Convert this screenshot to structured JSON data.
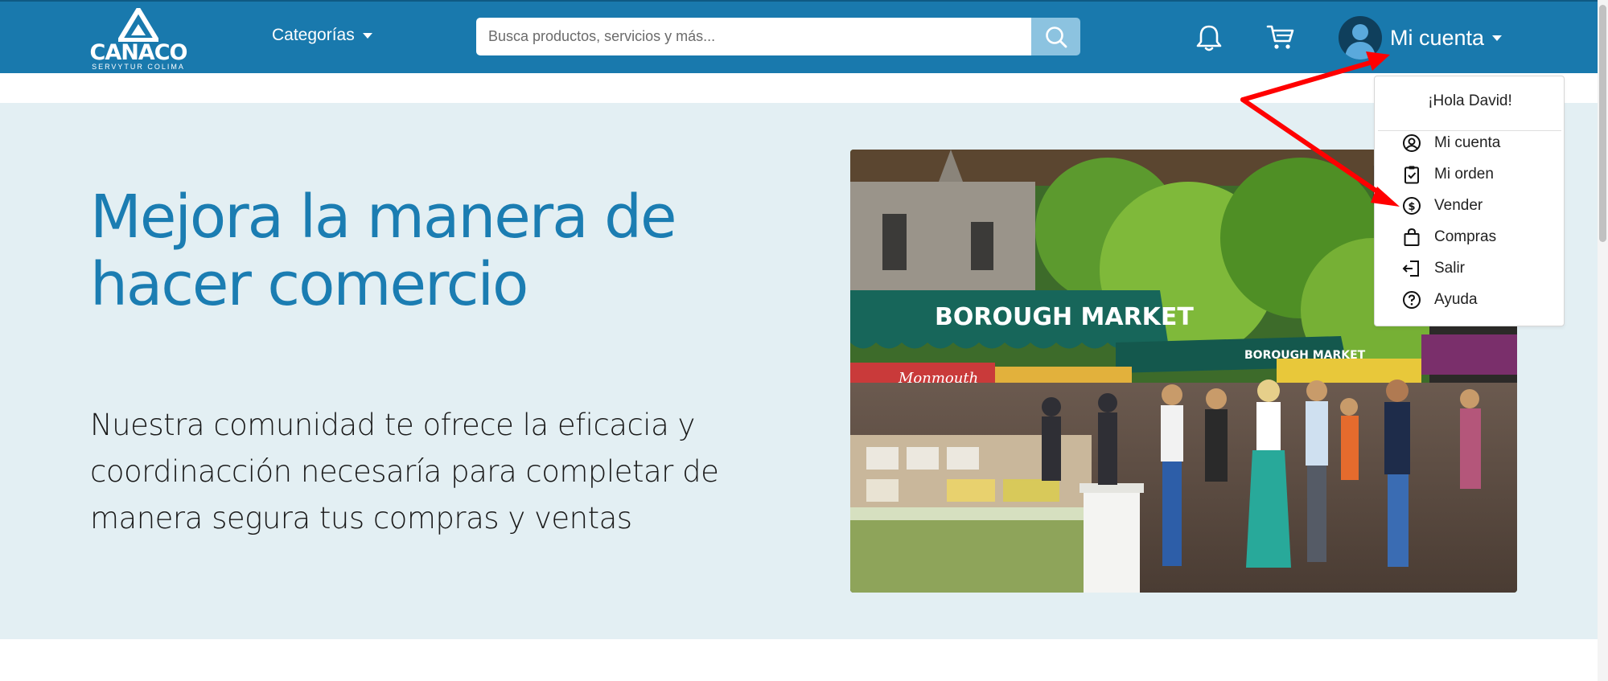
{
  "navbar": {
    "logo_text": "CANACO",
    "logo_sub": "SERVYTUR COLIMA",
    "categories_label": "Categorías",
    "search_placeholder": "Busca productos, servicios y más...",
    "account_label": "Mi cuenta",
    "icons": [
      "search-icon",
      "bell-icon",
      "cart-icon",
      "avatar-icon"
    ],
    "colors": {
      "bar": "#1979ad",
      "search_button": "#8cc3e0"
    }
  },
  "hero": {
    "title": "Mejora la manera de hacer comercio",
    "text": "Nuestra comunidad te ofrece la eficacia y coordinacción necesaría para completar de manera segura tus compras y ventas",
    "photo_signs": [
      "BOROUGH MARKET",
      "BOROUGH MARKET",
      "Monmouth"
    ],
    "colors": {
      "background": "#e3eff3",
      "title": "#1b7db2"
    }
  },
  "dropdown": {
    "greeting": "¡Hola David!",
    "items": [
      {
        "label": "Mi cuenta",
        "icon": "user-circle-icon"
      },
      {
        "label": "Mi orden",
        "icon": "clipboard-check-icon"
      },
      {
        "label": "Vender",
        "icon": "dollar-circle-icon"
      },
      {
        "label": "Compras",
        "icon": "bag-icon"
      },
      {
        "label": "Salir",
        "icon": "logout-icon"
      },
      {
        "label": "Ayuda",
        "icon": "help-circle-icon"
      }
    ]
  },
  "annotation": {
    "arrow_color": "#ff0000"
  }
}
